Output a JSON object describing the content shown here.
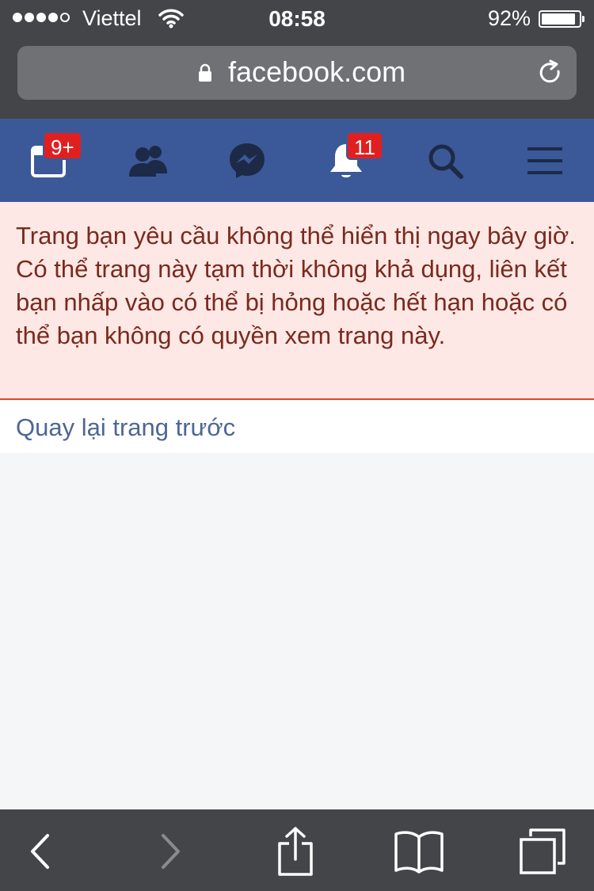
{
  "status_bar": {
    "carrier": "Viettel",
    "time": "08:58",
    "battery_percent": "92%",
    "battery_level": 0.92,
    "signal_bars_filled": 4,
    "signal_bars_total": 5
  },
  "browser": {
    "url": "facebook.com"
  },
  "fb_nav": {
    "feed_badge": "9+",
    "notifications_badge": "11",
    "brand_color": "#3b5998"
  },
  "error": {
    "message": "Trang bạn yêu cầu không thể hiển thị ngay bây giờ. Có thể trang này tạm thời không khả dụng, liên kết bạn nhấp vào có thể bị hỏng hoặc hết hạn hoặc có thể bạn không có quyền xem trang này.",
    "back_link": "Quay lại trang trước"
  },
  "icons": {
    "nav": [
      "news-feed-icon",
      "friends-icon",
      "messenger-icon",
      "bell-icon",
      "search-icon",
      "menu-icon"
    ],
    "toolbar": [
      "back-icon",
      "forward-icon",
      "share-icon",
      "bookmarks-icon",
      "tabs-icon"
    ]
  }
}
